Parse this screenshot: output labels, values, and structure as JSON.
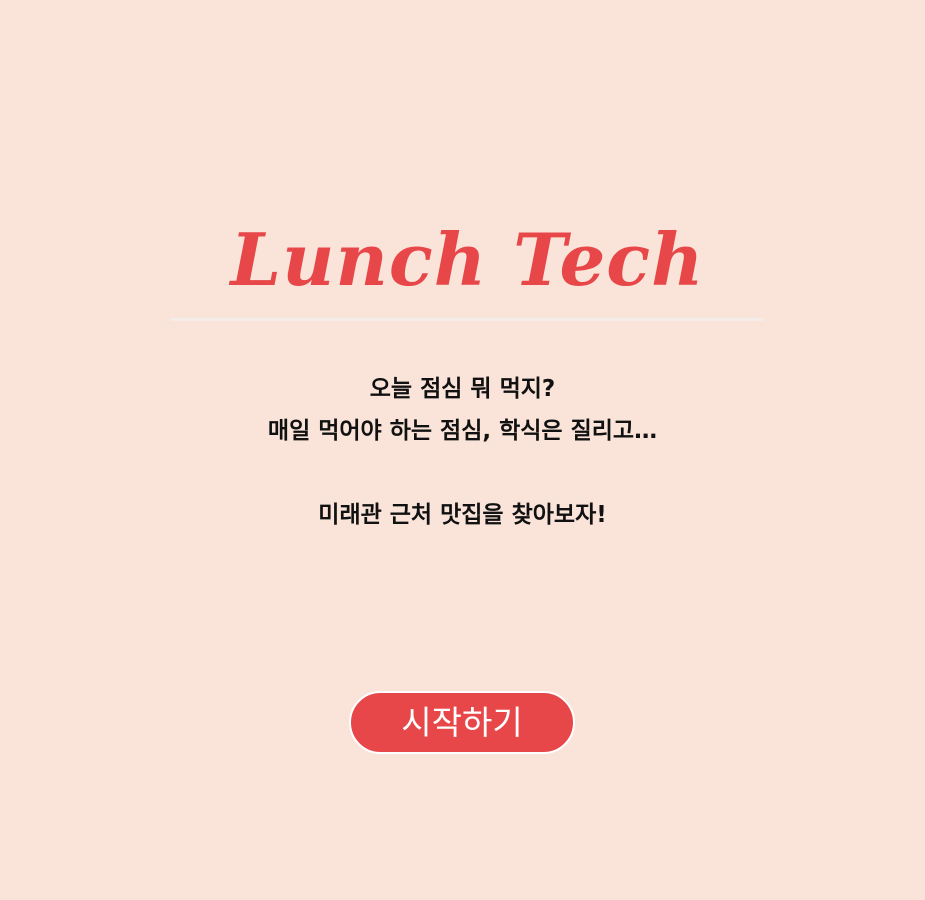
{
  "app": {
    "title": "Lunch Tech"
  },
  "intro": {
    "line1": "오늘 점심 뭐 먹지?",
    "line2": "매일 먹어야 하는 점심, 학식은 질리고…",
    "line3": "미래관 근처 맛집을 찾아보자!"
  },
  "actions": {
    "start_label": "시작하기"
  },
  "colors": {
    "background": "#fae4d9",
    "accent": "#e8474a",
    "divider": "#f3ece8",
    "text": "#111111"
  }
}
